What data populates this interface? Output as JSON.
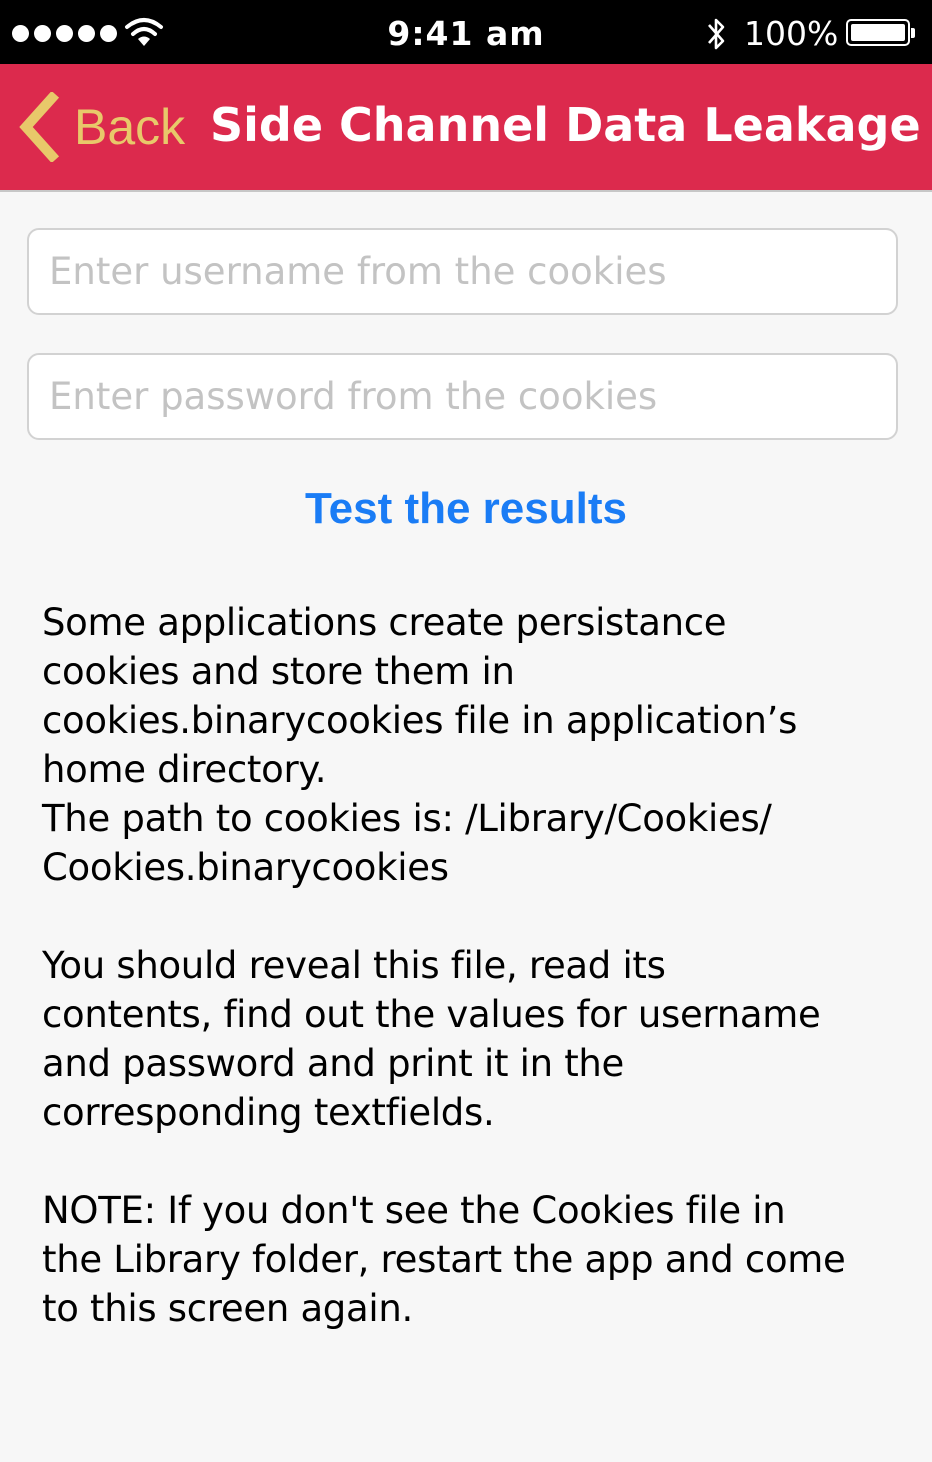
{
  "status_bar": {
    "time": "9:41 am",
    "battery_percent": "100%",
    "signal_bars": 5,
    "battery_level": 1.0,
    "icons": [
      "signal-dots-icon",
      "wifi-icon",
      "bluetooth-icon",
      "battery-icon"
    ]
  },
  "nav": {
    "back_label": "Back",
    "title": "Side Channel Data Leakage",
    "back_color": "#e8c86a",
    "bar_color": "#dc2a4d"
  },
  "form": {
    "username_placeholder": "Enter username from the cookies",
    "username_value": "",
    "password_placeholder": "Enter password from the cookies",
    "password_value": "",
    "test_label": "Test the results",
    "accent_color": "#1a7cf5"
  },
  "description": {
    "p1": [
      "Some applications create persistance",
      "cookies and store them in",
      "cookies.binarycookies file in application’s",
      "home directory.",
      "The path to cookies is: /Library/Cookies/",
      "Cookies.binarycookies"
    ],
    "p2": [
      "You should reveal this file, read its",
      "contents, find out the values for username",
      "and password and print it in the",
      "corresponding textfields."
    ],
    "p3": [
      "NOTE: If you don't see the Cookies file in",
      "the Library folder, restart the app and come",
      "to this screen again."
    ]
  }
}
